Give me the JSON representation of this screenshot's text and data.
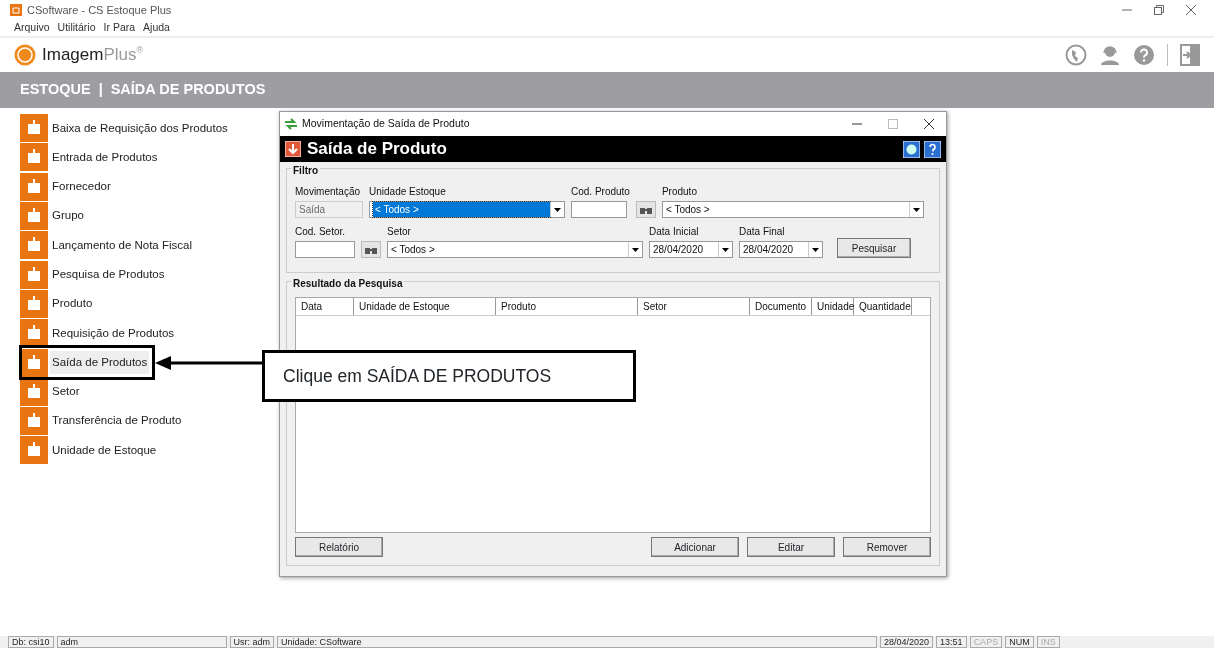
{
  "window": {
    "title": "CSoftware - CS Estoque Plus"
  },
  "menu": [
    "Arquivo",
    "Utilitário",
    "Ir Para",
    "Ajuda"
  ],
  "brand": {
    "name": "Imagem",
    "suffix": "Plus",
    "mark": "®"
  },
  "breadcrumb": {
    "section": "ESTOQUE",
    "separator": "|",
    "page": "SAÍDA DE PRODUTOS"
  },
  "sidebar": {
    "items": [
      {
        "label": "Baixa de Requisição dos Produtos",
        "selected": false
      },
      {
        "label": "Entrada de Produtos",
        "selected": false
      },
      {
        "label": "Fornecedor",
        "selected": false
      },
      {
        "label": "Grupo",
        "selected": false
      },
      {
        "label": "Lançamento de Nota Fiscal",
        "selected": false
      },
      {
        "label": "Pesquisa de Produtos",
        "selected": false
      },
      {
        "label": "Produto",
        "selected": false
      },
      {
        "label": "Requisição de Produtos",
        "selected": false
      },
      {
        "label": "Saída de Produtos",
        "selected": true
      },
      {
        "label": "Setor",
        "selected": false
      },
      {
        "label": "Transferência de Produto",
        "selected": false
      },
      {
        "label": "Unidade de Estoque",
        "selected": false
      }
    ]
  },
  "dialog": {
    "title": "Movimentação de Saída de Produto",
    "heading": "Saída de Produto",
    "filter": {
      "legend": "Filtro",
      "lines": [
        {
          "fields": [
            {
              "kind": "text",
              "label": "Movimentação",
              "value": "Saída",
              "disabled": true
            },
            {
              "kind": "select",
              "label": "Unidade Estoque",
              "value": "< Todos >",
              "focused": true
            },
            {
              "kind": "lookup",
              "label": "Cod. Produto"
            },
            {
              "kind": "select",
              "label": "Produto",
              "value": "< Todos >",
              "focused": false
            }
          ]
        },
        {
          "fields": [
            {
              "kind": "lookup",
              "label": "Cod. Setor."
            },
            {
              "kind": "select",
              "label": "Setor",
              "value": "< Todos >",
              "focused": false
            },
            {
              "kind": "select",
              "label": "Data Inicial",
              "value": "28/04/2020",
              "focused": false
            },
            {
              "kind": "select",
              "label": "Data Final",
              "value": "28/04/2020",
              "focused": false
            }
          ]
        }
      ],
      "search_button": "Pesquisar"
    },
    "results": {
      "legend": "Resultado da Pesquisa",
      "columns": [
        "Data",
        "Unidade de Estoque",
        "Produto",
        "Setor",
        "Documento",
        "Unidade",
        "Quantidade"
      ]
    },
    "buttons_left": [
      "Relatório"
    ],
    "buttons_right": [
      "Adicionar",
      "Editar",
      "Remover"
    ]
  },
  "callout": {
    "text": "Clique em SAÍDA DE PRODUTOS"
  },
  "status_bar": {
    "left": [
      "Db: csi10",
      "adm",
      "Usr: adm",
      "Unidade: CSoftware"
    ],
    "right": [
      {
        "text": "28/04/2020",
        "on": true
      },
      {
        "text": "13:51",
        "on": true
      },
      {
        "text": "CAPS",
        "on": false
      },
      {
        "text": "NUM",
        "on": true
      },
      {
        "text": "INS",
        "on": false
      }
    ]
  }
}
